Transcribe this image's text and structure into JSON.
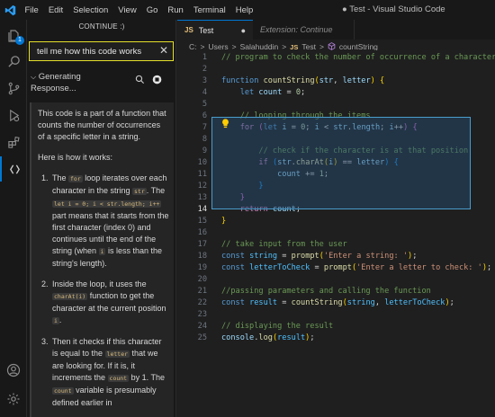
{
  "titlebar": {
    "menu": [
      "File",
      "Edit",
      "Selection",
      "View",
      "Go",
      "Run",
      "Terminal",
      "Help"
    ],
    "window_title": "● Test - Visual Studio Code"
  },
  "activity": {
    "explorer_badge": "1",
    "icons": [
      "explorer-icon",
      "search-icon",
      "source-control-icon",
      "run-debug-icon",
      "extensions-icon",
      "continue-icon",
      "account-icon",
      "settings-gear-icon"
    ]
  },
  "sidebar": {
    "title": "CONTINUE :)",
    "input_value": "tell me how this code works",
    "generating_label": "Generating",
    "generating_label2": "Response...",
    "chat": {
      "intro": "This code is a part of a function that counts the number of occurrences of a specific letter in a string.",
      "how": "Here is how it works:",
      "items": [
        {
          "a": "The ",
          "c1": "for",
          "b": " loop iterates over each character in the string ",
          "c2": "str",
          "d": ". The ",
          "c3": "let i = 0; i < str.length; i++",
          "e": " part means that it starts from the first character (index 0) and continues until the end of the string (when ",
          "c4": "i",
          "f": " is less than the string's length)."
        },
        {
          "a": "Inside the loop, it uses the ",
          "c1": "charAt(i)",
          "b": " function to get the character at the current position ",
          "c2": "i",
          "d": "."
        },
        {
          "a": "Then it checks if this character is equal to the ",
          "c1": "letter",
          "b": " that we are looking for. If it is, it increments the ",
          "c2": "count",
          "d": " by 1. The ",
          "c3": "count",
          "e": " variable is presumably defined earlier in"
        }
      ]
    }
  },
  "tabs": [
    {
      "label": "Test",
      "icon": "JS",
      "modified": "●"
    },
    {
      "label": "Extension: Continue"
    }
  ],
  "breadcrumb": [
    "C:",
    "Users",
    "Salahuddin",
    "Test",
    "countString"
  ],
  "breadcrumb_sep": ">",
  "editor": {
    "lines": [
      {
        "n": "1",
        "text": "// program to check the number of occurrence of a character"
      },
      {
        "n": "2",
        "text": ""
      },
      {
        "n": "3",
        "text": "function countString(str, letter) {"
      },
      {
        "n": "4",
        "text": "    let count = 0;"
      },
      {
        "n": "5",
        "text": ""
      },
      {
        "n": "6",
        "text": "    // looping through the items"
      },
      {
        "n": "7",
        "text": "    for (let i = 0; i < str.length; i++) {"
      },
      {
        "n": "8",
        "text": ""
      },
      {
        "n": "9",
        "text": "        // check if the character is at that position"
      },
      {
        "n": "10",
        "text": "        if (str.charAt(i) == letter) {"
      },
      {
        "n": "11",
        "text": "            count += 1;"
      },
      {
        "n": "12",
        "text": "        }"
      },
      {
        "n": "13",
        "text": "    }"
      },
      {
        "n": "14",
        "text": "    return count;"
      },
      {
        "n": "15",
        "text": "}"
      },
      {
        "n": "16",
        "text": ""
      },
      {
        "n": "17",
        "text": "// take input from the user"
      },
      {
        "n": "18",
        "text": "const string = prompt('Enter a string: ');"
      },
      {
        "n": "19",
        "text": "const letterToCheck = prompt('Enter a letter to check: ');"
      },
      {
        "n": "20",
        "text": ""
      },
      {
        "n": "21",
        "text": "//passing parameters and calling the function"
      },
      {
        "n": "22",
        "text": "const result = countString(string, letterToCheck);"
      },
      {
        "n": "23",
        "text": ""
      },
      {
        "n": "24",
        "text": "// displaying the result"
      },
      {
        "n": "25",
        "text": "console.log(result);"
      }
    ],
    "current_line": "14"
  },
  "colors": {
    "accent": "#0078d4",
    "input_border": "#e5e02c",
    "selection": "#264f78"
  }
}
